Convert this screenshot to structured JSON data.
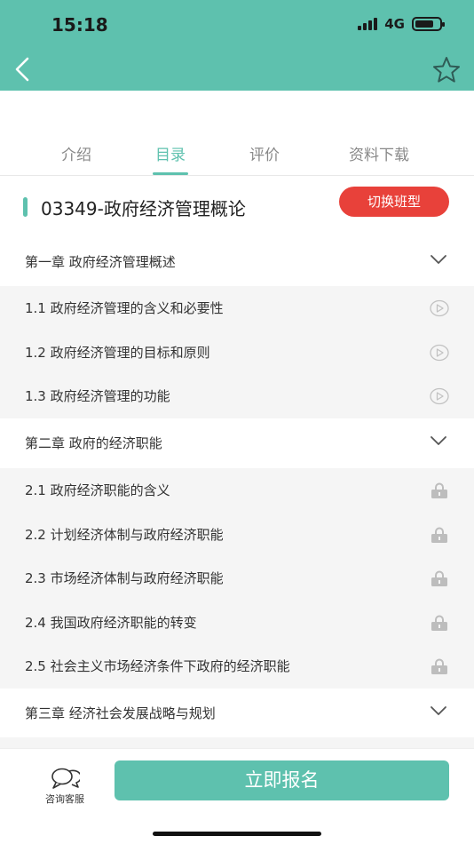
{
  "status": {
    "time": "15:18",
    "network": "4G"
  },
  "tabs": [
    {
      "label": "介绍",
      "active": false
    },
    {
      "label": "目录",
      "active": true
    },
    {
      "label": "评价",
      "active": false
    },
    {
      "label": "资料下载",
      "active": false
    }
  ],
  "course": {
    "title": "03349-政府经济管理概论",
    "switch_label": "切换班型"
  },
  "chapters": [
    {
      "title": "第一章 政府经济管理概述",
      "lessons": [
        {
          "label": "1.1 政府经济管理的含义和必要性",
          "icon": "play-icon"
        },
        {
          "label": "1.2 政府经济管理的目标和原则",
          "icon": "play-icon"
        },
        {
          "label": "1.3 政府经济管理的功能",
          "icon": "play-icon"
        }
      ]
    },
    {
      "title": "第二章 政府的经济职能",
      "lessons": [
        {
          "label": "2.1 政府经济职能的含义",
          "icon": "lock-icon"
        },
        {
          "label": "2.2 计划经济体制与政府经济职能",
          "icon": "lock-icon"
        },
        {
          "label": "2.3 市场经济体制与政府经济职能",
          "icon": "lock-icon"
        },
        {
          "label": "2.4 我国政府经济职能的转变",
          "icon": "lock-icon"
        },
        {
          "label": "2.5 社会主义市场经济条件下政府的经济职能",
          "icon": "lock-icon"
        }
      ]
    },
    {
      "title": "第三章 经济社会发展战略与规划",
      "lessons": []
    }
  ],
  "bottom": {
    "consult_label": "咨询客服",
    "enroll_label": "立即报名"
  },
  "colors": {
    "accent": "#5ec1ae",
    "danger": "#e8413a"
  }
}
